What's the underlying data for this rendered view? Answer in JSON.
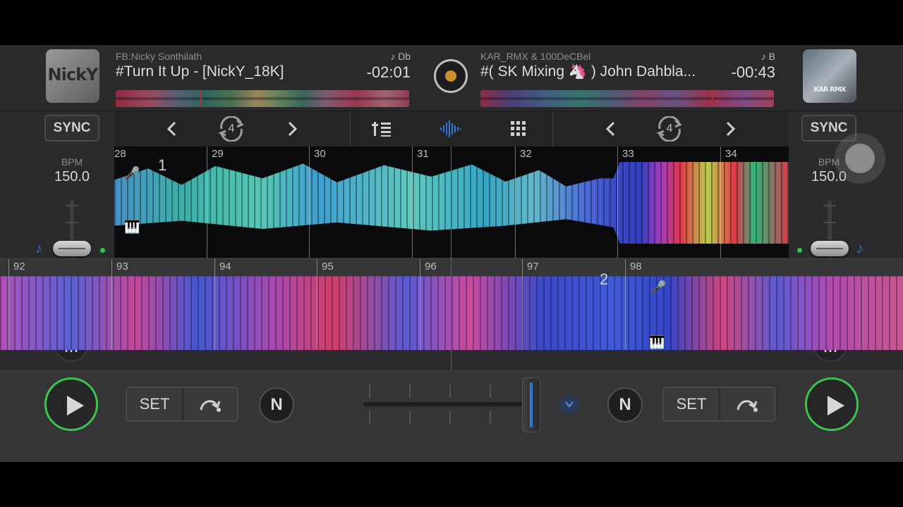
{
  "deck_left": {
    "artwork_text": "NickY",
    "artist": "FB:Nicky Sonthilath",
    "key": "♪ Db",
    "title": "#Turn It Up - [NickY_18K]",
    "remaining": "-02:01",
    "sync_label": "SYNC",
    "bpm_label": "BPM",
    "bpm_value": "150.0",
    "loop_size": "4",
    "set_label": "SET"
  },
  "deck_right": {
    "artwork_text": "KAR RMX",
    "artist": "KAR_RMX & 100DeCBel",
    "key": "♪ B",
    "title": "#( SK Mixing 🦄 ) John Dahbla...",
    "remaining": "-00:43",
    "sync_label": "SYNC",
    "bpm_label": "BPM",
    "bpm_value": "150.0",
    "loop_size": "4",
    "set_label": "SET"
  },
  "waveform_top": {
    "beats": [
      "28",
      "29",
      "30",
      "31",
      "32",
      "33",
      "34"
    ],
    "cue_number": "1"
  },
  "waveform_bottom": {
    "beats": [
      "92",
      "93",
      "94",
      "95",
      "96",
      "97",
      "98"
    ],
    "cue_number": "2"
  },
  "toolbar": {
    "left_prev_icon": "chevron-left-icon",
    "left_loop_icon": "loop-icon",
    "left_next_icon": "chevron-right-icon",
    "mixer_icon": "mixer-icon",
    "waveform_icon": "waveform-icon",
    "pads_icon": "grid-icon",
    "right_prev_icon": "chevron-left-icon",
    "right_loop_icon": "loop-icon",
    "right_next_icon": "chevron-right-icon"
  },
  "colors": {
    "play_ring": "#3cc44c",
    "playhead": "#d83030",
    "accent_blue": "#2e7bd6",
    "master_dot": "#c8922a"
  },
  "bottom": {
    "n_button_label": "N",
    "crossfader_position": 1.0
  }
}
